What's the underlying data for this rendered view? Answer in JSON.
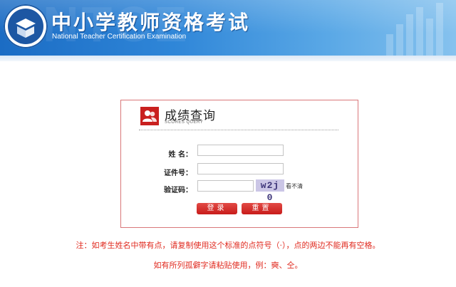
{
  "header": {
    "title": "中小学教师资格考试",
    "subtitle": "National Teacher Certification Examination",
    "watermark": "NTCE",
    "colors": {
      "banner_start": "#1b6cc4",
      "banner_end": "#86c2ee"
    },
    "emblem_icon": "book-emblem-icon"
  },
  "panel": {
    "title": "成绩查询",
    "subtitle": "SCORES QUERY",
    "icon": "users-icon",
    "accent_color": "#c9201f",
    "fields": {
      "name_label": "姓  名：",
      "name_value": "",
      "id_label": "证件号：",
      "id_value": "",
      "captcha_label": "验证码：",
      "captcha_value": "",
      "captcha_image_text": "w2j 0",
      "refresh_text": "看不清"
    },
    "buttons": {
      "submit": "登录",
      "reset": "重置"
    }
  },
  "notes": {
    "line1": "注：如考生姓名中带有点，请复制使用这个标准的点符号（·），点的两边不能再有空格。",
    "line2": "如有所列孤僻字请粘贴使用，例：奭、仝。",
    "color": "#e02a1f"
  }
}
